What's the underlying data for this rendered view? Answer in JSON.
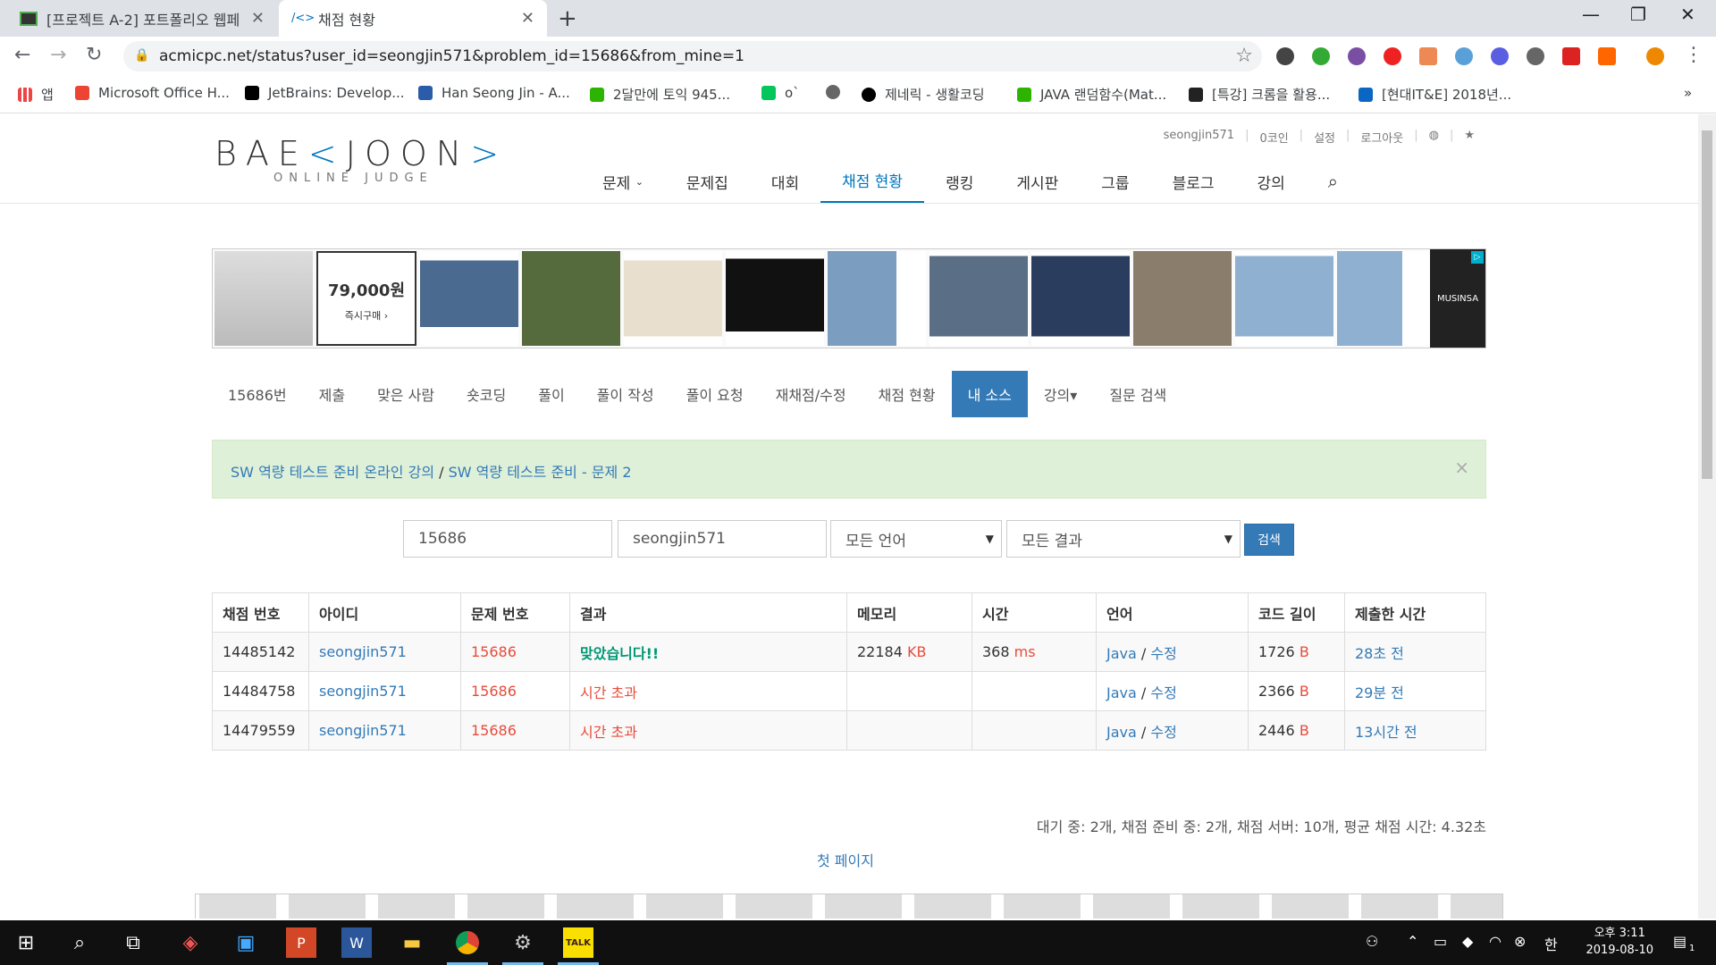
{
  "browser": {
    "tabs": [
      {
        "title": "[프로젝트 A-2] 포트폴리오 웹페",
        "active": false
      },
      {
        "title": "채점 현황",
        "active": true
      }
    ],
    "url": "acmicpc.net/status?user_id=seongjin571&problem_id=15686&from_mine=1",
    "bookmarks": [
      "앱",
      "Microsoft Office H...",
      "JetBrains: Develop...",
      "Han Seong Jin - A...",
      "2달만에 토익 945...",
      "o`",
      "",
      "제네릭 - 생활코딩",
      "JAVA 랜덤함수(Mat...",
      "[특강] 크롬을 활용...",
      "[현대IT&E] 2018년..."
    ]
  },
  "site": {
    "logo_main_a": "BAE",
    "logo_main_b": "<",
    "logo_main_c": "JOON",
    "logo_main_d": ">",
    "logo_sub": "ONLINE JUDGE",
    "user": "seongjin571",
    "coins": "0코인",
    "settings": "설정",
    "logout": "로그아웃",
    "nav": [
      "문제",
      "문제집",
      "대회",
      "채점 현황",
      "랭킹",
      "게시판",
      "그룹",
      "블로그",
      "강의"
    ]
  },
  "ad": {
    "price": "79,000원",
    "buy": "즉시구매 ›",
    "brand": "MUSINSA"
  },
  "problem_menu": [
    "15686번",
    "제출",
    "맞은 사람",
    "숏코딩",
    "풀이",
    "풀이 작성",
    "풀이 요청",
    "재채점/수정",
    "채점 현황",
    "내 소스",
    "강의▾",
    "질문 검색"
  ],
  "alert": {
    "link1": "SW 역량 테스트 준비 온라인 강의",
    "sep": " / ",
    "link2": "SW 역량 테스트 준비 - 문제 2"
  },
  "filter": {
    "problem_id": "15686",
    "user_id": "seongjin571",
    "language": "모든 언어",
    "result": "모든 결과",
    "search_label": "검색"
  },
  "table": {
    "headers": [
      "채점 번호",
      "아이디",
      "문제 번호",
      "결과",
      "메모리",
      "시간",
      "언어",
      "코드 길이",
      "제출한 시간"
    ],
    "rows": [
      {
        "id": "14485142",
        "user": "seongjin571",
        "problem": "15686",
        "result": "맞았습니다!!",
        "memory": "22184",
        "memory_unit": "KB",
        "time": "368",
        "time_unit": "ms",
        "lang": "Java",
        "edit": "수정",
        "length": "1726",
        "length_unit": "B",
        "submitted": "28초 전"
      },
      {
        "id": "14484758",
        "user": "seongjin571",
        "problem": "15686",
        "result": "시간 초과",
        "memory": "",
        "memory_unit": "",
        "time": "",
        "time_unit": "",
        "lang": "Java",
        "edit": "수정",
        "length": "2366",
        "length_unit": "B",
        "submitted": "29분 전"
      },
      {
        "id": "14479559",
        "user": "seongjin571",
        "problem": "15686",
        "result": "시간 초과",
        "memory": "",
        "memory_unit": "",
        "time": "",
        "time_unit": "",
        "lang": "Java",
        "edit": "수정",
        "length": "2446",
        "length_unit": "B",
        "submitted": "13시간 전"
      }
    ]
  },
  "queue_status": "대기 중: 2개, 채점 준비 중: 2개, 채점 서버: 10개, 평균 채점 시간: 4.32초",
  "first_page": "첫 페이지",
  "taskbar": {
    "ime": "한",
    "time": "오후 3:11",
    "date": "2019-08-10",
    "notif_count": "1"
  },
  "colors": {
    "accent": "#0076c0",
    "link": "#337ab7",
    "error": "#e74c3c",
    "accepted": "#009874",
    "alert_bg": "#dff0d8"
  }
}
